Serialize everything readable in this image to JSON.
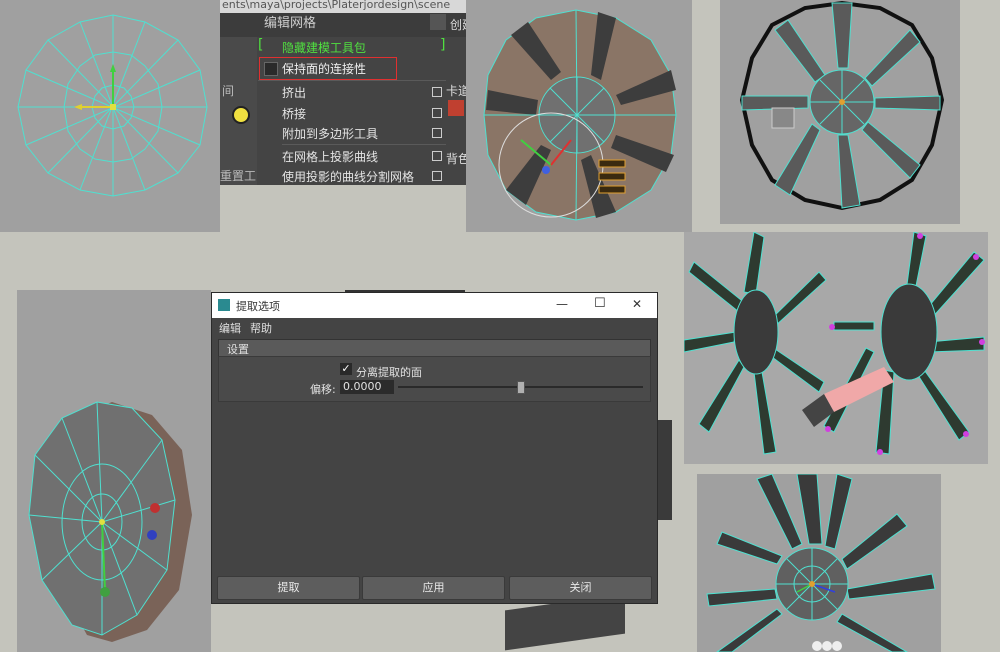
{
  "menu": {
    "path_text": "ents\\maya\\projects\\Platerjordesign\\scene",
    "title": "编辑网格",
    "right_tab": "创建",
    "hide_toolkit": "隐藏建模工具包",
    "keep_faces": "保持面的连接性",
    "left_fragment_1": "间",
    "left_fragment_2": "重置工",
    "right_fragment_1": "卡道",
    "right_fragment_2": "背色",
    "items": [
      {
        "label": "挤出"
      },
      {
        "label": "桥接"
      },
      {
        "label": "附加到多边形工具"
      },
      {
        "label": "在网格上投影曲线"
      },
      {
        "label": "使用投影的曲线分割网格"
      }
    ]
  },
  "dialog": {
    "title": "提取选项",
    "menu_edit": "编辑",
    "menu_help": "帮助",
    "section": "设置",
    "checkbox_label": "分离提取的面",
    "offset_label": "偏移:",
    "offset_value": "0.0000",
    "buttons": {
      "extract": "提取",
      "apply": "应用",
      "close": "关闭"
    },
    "window_controls": {
      "minimize": "—",
      "maximize": "☐",
      "close": "✕"
    }
  },
  "colors": {
    "wire": "#4fe0d0",
    "face": "#8a7060",
    "viewport": "#a0a0a0",
    "highlight_red": "#e03030",
    "maya_green": "#50d040"
  }
}
